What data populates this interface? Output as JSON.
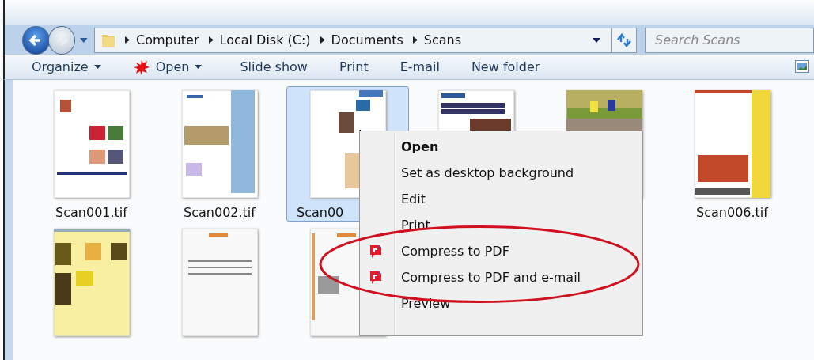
{
  "address": {
    "crumbs": [
      "Computer",
      "Local Disk (C:)",
      "Documents",
      "Scans"
    ]
  },
  "search": {
    "placeholder": "Search Scans"
  },
  "toolbar": [
    {
      "label": "Organize",
      "kind": "menu"
    },
    {
      "label": "Open",
      "kind": "open"
    },
    {
      "label": "Slide show",
      "kind": "plain"
    },
    {
      "label": "Print",
      "kind": "plain"
    },
    {
      "label": "E-mail",
      "kind": "plain"
    },
    {
      "label": "New folder",
      "kind": "plain"
    }
  ],
  "files": [
    {
      "label": "Scan001.tif",
      "selected": false,
      "covered": false
    },
    {
      "label": "Scan002.tif",
      "selected": false,
      "covered": false
    },
    {
      "label": "Scan00",
      "selected": true,
      "covered": true
    },
    {
      "selected": false
    },
    {
      "selected": false
    },
    {
      "label": "Scan006.tif",
      "selected": false,
      "covered": false
    },
    {
      "selected": false
    },
    {
      "selected": false
    },
    {
      "selected": false
    }
  ],
  "context_menu": [
    {
      "label": "Open",
      "kind": "default"
    },
    {
      "label": "Set as desktop background",
      "kind": "plain"
    },
    {
      "label": "Edit",
      "kind": "plain"
    },
    {
      "label": "Print",
      "kind": "plain"
    },
    {
      "label": "Compress to PDF",
      "kind": "pdf"
    },
    {
      "label": "Compress to PDF and e-mail",
      "kind": "pdf"
    },
    {
      "label": "Preview",
      "kind": "plain"
    }
  ]
}
